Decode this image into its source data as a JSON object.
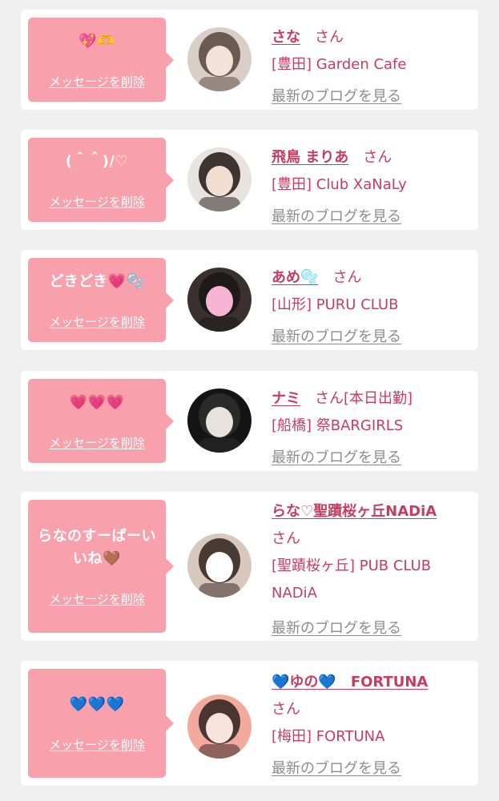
{
  "items": [
    {
      "message": "💖🫶",
      "delete_label": "メッセージを削除",
      "name": "さな",
      "san": "さん",
      "name_suffix": "",
      "shop": "[豊田] Garden Cafe",
      "blog_link": "最新のブログを見る",
      "avatar_colors": [
        "#d9cfc8",
        "#6b5a52",
        "#f4e2d8"
      ]
    },
    {
      "message": "(＾＾)/♡",
      "delete_label": "メッセージを削除",
      "name": "飛鳥 まりあ",
      "san": "さん",
      "name_suffix": "",
      "shop": "[豊田] Club XaNaLy",
      "blog_link": "最新のブログを見る",
      "avatar_colors": [
        "#e8e3df",
        "#3e3432",
        "#f1ddd1"
      ]
    },
    {
      "message": "どきどき💗🫧",
      "delete_label": "メッセージを削除",
      "name": "あめ🫧",
      "san": "さん",
      "name_suffix": "",
      "shop": "[山形] PURU CLUB",
      "blog_link": "最新のブログを見る",
      "avatar_colors": [
        "#3a3030",
        "#1e1a1a",
        "#f7b4d4"
      ]
    },
    {
      "message": "💗💗💗",
      "delete_label": "メッセージを削除",
      "name": "ナミ",
      "san": "さん",
      "name_suffix": "[本日出勤]",
      "shop": "[船橋] 祭BARGIRLS",
      "blog_link": "最新のブログを見る",
      "avatar_colors": [
        "#141414",
        "#2a2a2a",
        "#e7e2dc"
      ]
    },
    {
      "message": "らなのすーぱーいいね🤎",
      "delete_label": "メッセージを削除",
      "name": "らな♡聖蹟桜ヶ丘NADiA",
      "san": "さん",
      "name_suffix": "",
      "shop": "[聖蹟桜ヶ丘] PUB CLUB NADiA",
      "blog_link": "最新のブログを見る",
      "avatar_colors": [
        "#d8c7bd",
        "#4a3a36",
        "#ffffff"
      ]
    },
    {
      "message": "💙💙💙",
      "delete_label": "メッセージを削除",
      "name": "💙ゆの💙　FORTUNA",
      "san": "さん",
      "name_suffix": "",
      "shop": "[梅田] FORTUNA",
      "blog_link": "最新のブログを見る",
      "avatar_colors": [
        "#f2a99e",
        "#4a3530",
        "#f8e4dc"
      ]
    }
  ]
}
